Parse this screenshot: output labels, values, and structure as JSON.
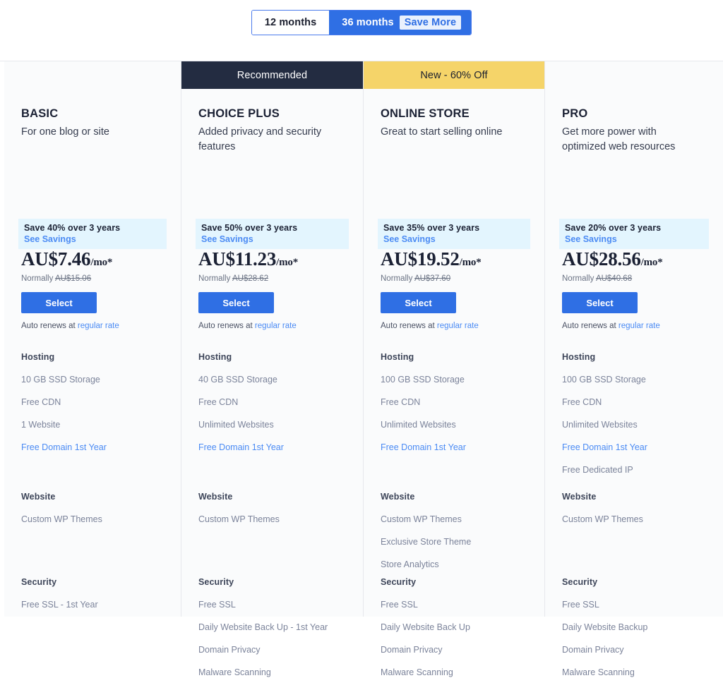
{
  "toggle": {
    "option_12": "12 months",
    "option_36": "36 months",
    "save_more_badge": "Save More",
    "active": "36 months",
    "accent_color": "#2f6fe4",
    "badge_bg": "#e9f1fd"
  },
  "banners": {
    "recommended": {
      "label": "Recommended",
      "bg": "#232c41",
      "color": "#ffffff"
    },
    "new_off": {
      "label": "New - 60% Off",
      "bg": "#f5d469",
      "color": "#1b1f2e"
    }
  },
  "labels": {
    "select_button": "Select",
    "normally_prefix": "Normally",
    "renews_prefix": "Auto renews at",
    "renews_link": "regular rate",
    "see_savings": "See Savings",
    "group_hosting": "Hosting",
    "group_website": "Website",
    "group_security": "Security"
  },
  "plans": [
    {
      "name": "BASIC",
      "description": "For one blog or site",
      "banner": null,
      "savings_text": "Save 40% over 3 years",
      "price": "AU$7.46",
      "price_period": "/mo*",
      "normally_price": "AU$15.06",
      "hosting": [
        {
          "text": "10 GB SSD Storage",
          "link": false
        },
        {
          "text": "Free CDN",
          "link": false
        },
        {
          "text": "1 Website",
          "link": false
        },
        {
          "text": "Free Domain 1st Year",
          "link": true
        }
      ],
      "website": [
        {
          "text": "Custom WP Themes",
          "link": false
        }
      ],
      "security": [
        {
          "text": "Free SSL - 1st Year",
          "link": false
        }
      ]
    },
    {
      "name": "CHOICE PLUS",
      "description": "Added privacy and security features",
      "banner": "Recommended",
      "savings_text": "Save 50% over 3 years",
      "price": "AU$11.23",
      "price_period": "/mo*",
      "normally_price": "AU$28.62",
      "hosting": [
        {
          "text": "40 GB SSD Storage",
          "link": false
        },
        {
          "text": "Free CDN",
          "link": false
        },
        {
          "text": "Unlimited Websites",
          "link": false
        },
        {
          "text": "Free Domain 1st Year",
          "link": true
        }
      ],
      "website": [
        {
          "text": "Custom WP Themes",
          "link": false
        }
      ],
      "security": [
        {
          "text": "Free SSL",
          "link": false
        },
        {
          "text": "Daily Website Back Up - 1st Year",
          "link": false
        },
        {
          "text": "Domain Privacy",
          "link": false
        },
        {
          "text": "Malware Scanning",
          "link": false
        }
      ]
    },
    {
      "name": "ONLINE STORE",
      "description": "Great to start selling online",
      "banner": "New - 60% Off",
      "savings_text": "Save 35% over 3 years",
      "price": "AU$19.52",
      "price_period": "/mo*",
      "normally_price": "AU$37.60",
      "hosting": [
        {
          "text": "100 GB SSD Storage",
          "link": false
        },
        {
          "text": "Free CDN",
          "link": false
        },
        {
          "text": "Unlimited Websites",
          "link": false
        },
        {
          "text": "Free Domain 1st Year",
          "link": true
        }
      ],
      "website": [
        {
          "text": "Custom WP Themes",
          "link": false
        },
        {
          "text": "Exclusive Store Theme",
          "link": false
        },
        {
          "text": "Store Analytics",
          "link": false
        }
      ],
      "security": [
        {
          "text": "Free SSL",
          "link": false
        },
        {
          "text": "Daily Website Back Up",
          "link": false
        },
        {
          "text": "Domain Privacy",
          "link": false
        },
        {
          "text": "Malware Scanning",
          "link": false
        }
      ]
    },
    {
      "name": "PRO",
      "description": "Get more power with optimized web resources",
      "banner": null,
      "savings_text": "Save 20% over 3 years",
      "price": "AU$28.56",
      "price_period": "/mo*",
      "normally_price": "AU$40.68",
      "hosting": [
        {
          "text": "100 GB SSD Storage",
          "link": false
        },
        {
          "text": "Free CDN",
          "link": false
        },
        {
          "text": "Unlimited Websites",
          "link": false
        },
        {
          "text": "Free Domain 1st Year",
          "link": true
        },
        {
          "text": "Free Dedicated IP",
          "link": false
        }
      ],
      "website": [
        {
          "text": "Custom WP Themes",
          "link": false
        }
      ],
      "security": [
        {
          "text": "Free SSL",
          "link": false
        },
        {
          "text": "Daily Website Backup",
          "link": false
        },
        {
          "text": "Domain Privacy",
          "link": false
        },
        {
          "text": "Malware Scanning",
          "link": false
        }
      ]
    }
  ]
}
